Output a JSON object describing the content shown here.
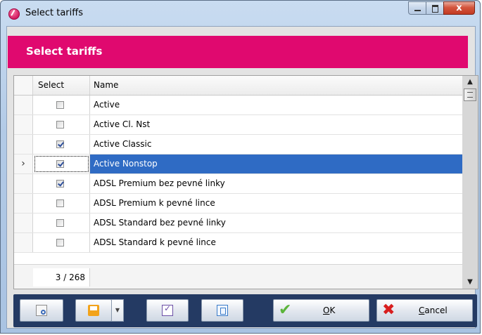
{
  "window": {
    "title": "Select tariffs"
  },
  "header": {
    "title": "Select tariffs"
  },
  "grid": {
    "columns": {
      "select": "Select",
      "name": "Name"
    },
    "rows": [
      {
        "name": "Active",
        "checked": false,
        "current": false
      },
      {
        "name": "Active Cl. Nst",
        "checked": false,
        "current": false
      },
      {
        "name": "Active Classic",
        "checked": true,
        "current": false
      },
      {
        "name": "Active Nonstop",
        "checked": true,
        "current": true
      },
      {
        "name": "ADSL Premium bez pevné  linky",
        "checked": true,
        "current": false
      },
      {
        "name": "ADSL Premium k pevné  lince",
        "checked": false,
        "current": false
      },
      {
        "name": "ADSL Standard bez pevné  linky",
        "checked": false,
        "current": false
      },
      {
        "name": "ADSL Standard k pevné  lince",
        "checked": false,
        "current": false
      }
    ],
    "counter": "3 / 268",
    "current_row_marker": "›"
  },
  "buttons": {
    "ok_label": "OK",
    "ok_mnemonic": "O",
    "ok_rest": "K",
    "cancel_label": "Cancel",
    "cancel_mnemonic": "C",
    "cancel_rest": "ancel"
  },
  "icons": {
    "app": "app-logo-icon",
    "preview": "print-preview-icon",
    "save": "save-icon",
    "dropdown": "chevron-down-icon",
    "check_all": "check-all-icon",
    "uncheck_all": "uncheck-all-icon",
    "ok": "checkmark-icon",
    "cancel": "red-x-icon"
  },
  "colors": {
    "header_band": "#e0096f",
    "selected_row": "#2f6bc4",
    "toolbar": "#243a63"
  }
}
